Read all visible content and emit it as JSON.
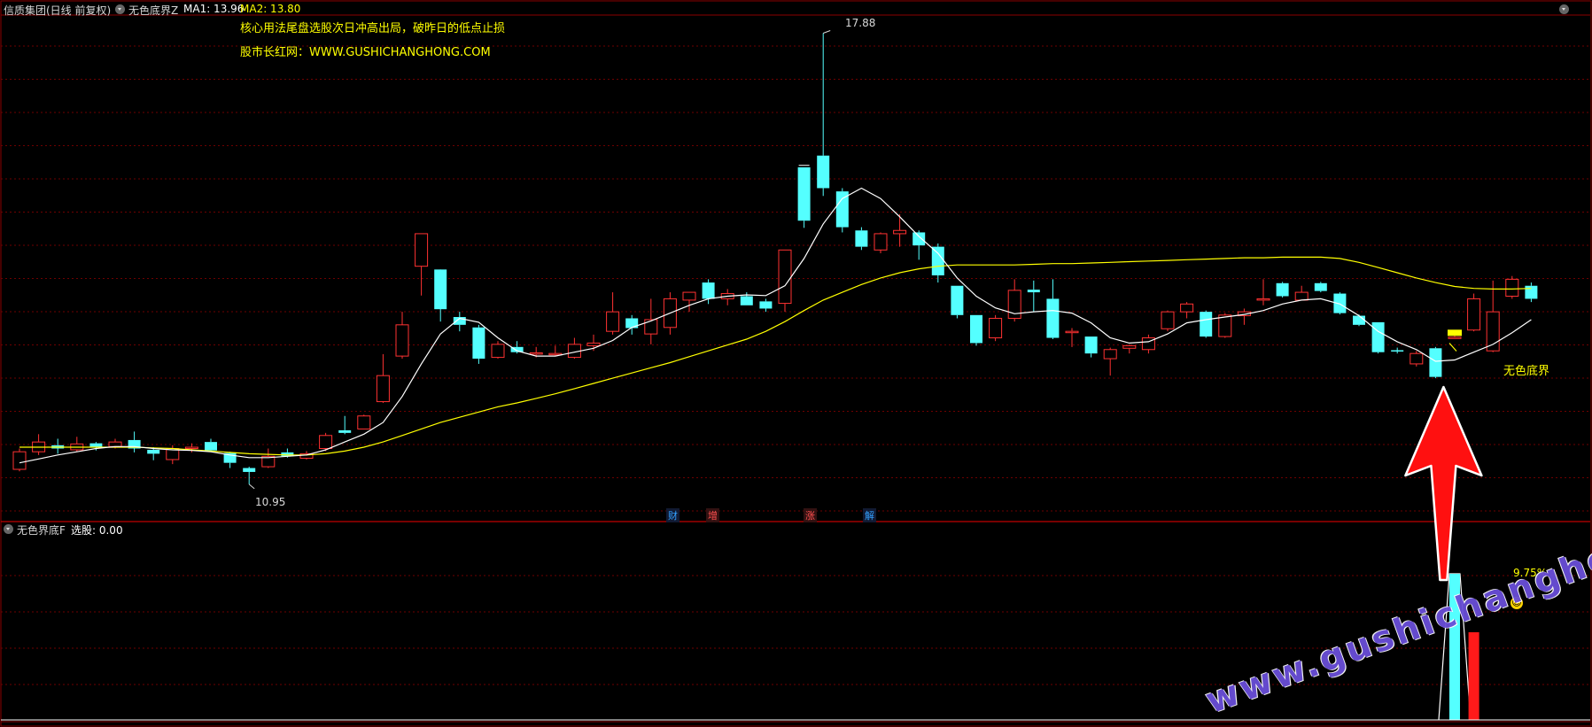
{
  "header": {
    "stock": "信质集团(日线 前复权)",
    "indicator": "无色底界Z",
    "ma1_label": "MA1: 13.96",
    "ma2_label": "MA2: 13.80"
  },
  "annotations": {
    "line1": "核心用法尾盘选股次日冲高出局，破昨日的低点止损",
    "line2": "股市长红网：WWW.GUSHICHANGHONG.COM"
  },
  "signal_label": "无色底界",
  "price_labels": {
    "high": "17.88",
    "low": "10.95"
  },
  "event_tags": [
    {
      "text": "财",
      "color": "#33a0ff"
    },
    {
      "text": "增",
      "color": "#ff5050"
    },
    {
      "text": "涨",
      "color": "#ff5050"
    },
    {
      "text": "解",
      "color": "#33a0ff"
    }
  ],
  "sub_panel": {
    "title": "无色界底F",
    "value_label": "选股: 0.00",
    "percent": "9.75%"
  },
  "watermark": "www.gushichanghong.com",
  "colors": {
    "up": "#ff3232",
    "down": "#54ffff",
    "ma1": "#ffffff",
    "ma2": "#ffff00",
    "grid": "#8b0000",
    "signal": "#ffff00"
  },
  "chart_data": {
    "type": "candlestick",
    "ylim": [
      10.5,
      18.2
    ],
    "highest": 17.88,
    "lowest": 10.95,
    "candles": [
      {
        "o": 11.18,
        "c": 11.45,
        "h": 11.5,
        "l": 11.15
      },
      {
        "o": 11.45,
        "c": 11.6,
        "h": 11.72,
        "l": 11.4
      },
      {
        "o": 11.55,
        "c": 11.5,
        "h": 11.65,
        "l": 11.42
      },
      {
        "o": 11.48,
        "c": 11.57,
        "h": 11.68,
        "l": 11.45
      },
      {
        "o": 11.58,
        "c": 11.52,
        "h": 11.6,
        "l": 11.47
      },
      {
        "o": 11.53,
        "c": 11.6,
        "h": 11.65,
        "l": 11.5
      },
      {
        "o": 11.63,
        "c": 11.5,
        "h": 11.76,
        "l": 11.44
      },
      {
        "o": 11.48,
        "c": 11.42,
        "h": 11.52,
        "l": 11.32
      },
      {
        "o": 11.33,
        "c": 11.5,
        "h": 11.55,
        "l": 11.26
      },
      {
        "o": 11.5,
        "c": 11.52,
        "h": 11.58,
        "l": 11.44
      },
      {
        "o": 11.6,
        "c": 11.47,
        "h": 11.65,
        "l": 11.45
      },
      {
        "o": 11.43,
        "c": 11.28,
        "h": 11.45,
        "l": 11.2
      },
      {
        "o": 11.2,
        "c": 11.14,
        "h": 11.22,
        "l": 10.95
      },
      {
        "o": 11.22,
        "c": 11.38,
        "h": 11.5,
        "l": 11.2
      },
      {
        "o": 11.44,
        "c": 11.38,
        "h": 11.5,
        "l": 11.36
      },
      {
        "o": 11.35,
        "c": 11.42,
        "h": 11.46,
        "l": 11.33
      },
      {
        "o": 11.5,
        "c": 11.7,
        "h": 11.74,
        "l": 11.46
      },
      {
        "o": 11.78,
        "c": 11.74,
        "h": 12.0,
        "l": 11.72
      },
      {
        "o": 11.8,
        "c": 12.0,
        "h": 12.02,
        "l": 11.8
      },
      {
        "o": 12.22,
        "c": 12.62,
        "h": 12.95,
        "l": 12.2
      },
      {
        "o": 12.92,
        "c": 13.4,
        "h": 13.6,
        "l": 12.88
      },
      {
        "o": 14.3,
        "c": 14.8,
        "h": 14.8,
        "l": 13.85
      },
      {
        "o": 14.25,
        "c": 13.64,
        "h": 13.64,
        "l": 13.45
      },
      {
        "o": 13.52,
        "c": 13.4,
        "h": 13.6,
        "l": 13.3
      },
      {
        "o": 13.36,
        "c": 12.88,
        "h": 13.4,
        "l": 12.8
      },
      {
        "o": 12.9,
        "c": 13.1,
        "h": 13.15,
        "l": 12.88
      },
      {
        "o": 13.06,
        "c": 12.98,
        "h": 13.15,
        "l": 12.96
      },
      {
        "o": 12.97,
        "c": 12.97,
        "h": 13.06,
        "l": 12.9
      },
      {
        "o": 12.95,
        "c": 12.96,
        "h": 13.08,
        "l": 12.92
      },
      {
        "o": 12.9,
        "c": 13.1,
        "h": 13.2,
        "l": 12.88
      },
      {
        "o": 13.08,
        "c": 13.12,
        "h": 13.25,
        "l": 13.0
      },
      {
        "o": 13.3,
        "c": 13.6,
        "h": 13.9,
        "l": 13.25
      },
      {
        "o": 13.5,
        "c": 13.35,
        "h": 13.55,
        "l": 13.25
      },
      {
        "o": 13.26,
        "c": 13.48,
        "h": 13.8,
        "l": 13.1
      },
      {
        "o": 13.36,
        "c": 13.8,
        "h": 13.9,
        "l": 13.25
      },
      {
        "o": 13.78,
        "c": 13.9,
        "h": 13.9,
        "l": 13.6
      },
      {
        "o": 14.05,
        "c": 13.8,
        "h": 14.1,
        "l": 13.72
      },
      {
        "o": 13.8,
        "c": 13.88,
        "h": 13.95,
        "l": 13.7
      },
      {
        "o": 13.84,
        "c": 13.7,
        "h": 13.9,
        "l": 13.7
      },
      {
        "o": 13.76,
        "c": 13.65,
        "h": 13.8,
        "l": 13.6
      },
      {
        "o": 13.73,
        "c": 14.55,
        "h": 14.55,
        "l": 13.6
      },
      {
        "o": 15.82,
        "c": 15.0,
        "h": 15.82,
        "l": 14.89
      },
      {
        "o": 16.0,
        "c": 15.5,
        "h": 17.88,
        "l": 15.38
      },
      {
        "o": 15.45,
        "c": 14.9,
        "h": 15.5,
        "l": 14.82
      },
      {
        "o": 14.85,
        "c": 14.6,
        "h": 14.9,
        "l": 14.55
      },
      {
        "o": 14.55,
        "c": 14.8,
        "h": 14.82,
        "l": 14.5
      },
      {
        "o": 14.8,
        "c": 14.85,
        "h": 15.1,
        "l": 14.6
      },
      {
        "o": 14.82,
        "c": 14.62,
        "h": 14.85,
        "l": 14.4
      },
      {
        "o": 14.6,
        "c": 14.16,
        "h": 14.65,
        "l": 14.05
      },
      {
        "o": 14.0,
        "c": 13.55,
        "h": 14.0,
        "l": 13.5
      },
      {
        "o": 13.55,
        "c": 13.12,
        "h": 13.55,
        "l": 13.08
      },
      {
        "o": 13.2,
        "c": 13.5,
        "h": 13.55,
        "l": 13.15
      },
      {
        "o": 13.5,
        "c": 13.93,
        "h": 14.1,
        "l": 13.45
      },
      {
        "o": 13.94,
        "c": 13.9,
        "h": 14.08,
        "l": 13.6
      },
      {
        "o": 13.8,
        "c": 13.2,
        "h": 14.1,
        "l": 13.18
      },
      {
        "o": 13.3,
        "c": 13.3,
        "h": 13.35,
        "l": 13.06
      },
      {
        "o": 13.22,
        "c": 12.96,
        "h": 13.22,
        "l": 12.9
      },
      {
        "o": 12.88,
        "c": 13.02,
        "h": 13.05,
        "l": 12.62
      },
      {
        "o": 13.04,
        "c": 13.08,
        "h": 13.1,
        "l": 12.96
      },
      {
        "o": 13.02,
        "c": 13.2,
        "h": 13.25,
        "l": 12.96
      },
      {
        "o": 13.34,
        "c": 13.6,
        "h": 13.62,
        "l": 13.3
      },
      {
        "o": 13.6,
        "c": 13.72,
        "h": 13.75,
        "l": 13.5
      },
      {
        "o": 13.6,
        "c": 13.22,
        "h": 13.62,
        "l": 13.2
      },
      {
        "o": 13.22,
        "c": 13.55,
        "h": 13.58,
        "l": 13.2
      },
      {
        "o": 13.54,
        "c": 13.6,
        "h": 13.65,
        "l": 13.4
      },
      {
        "o": 13.78,
        "c": 13.8,
        "h": 14.1,
        "l": 13.7
      },
      {
        "o": 14.04,
        "c": 13.84,
        "h": 14.06,
        "l": 13.82
      },
      {
        "o": 13.78,
        "c": 13.9,
        "h": 14.0,
        "l": 13.78
      },
      {
        "o": 14.04,
        "c": 13.92,
        "h": 14.06,
        "l": 13.9
      },
      {
        "o": 13.88,
        "c": 13.58,
        "h": 13.9,
        "l": 13.56
      },
      {
        "o": 13.54,
        "c": 13.4,
        "h": 13.56,
        "l": 13.38
      },
      {
        "o": 13.44,
        "c": 12.98,
        "h": 13.44,
        "l": 12.96
      },
      {
        "o": 13.01,
        "c": 13.0,
        "h": 13.05,
        "l": 12.96
      },
      {
        "o": 12.8,
        "c": 12.96,
        "h": 13.0,
        "l": 12.76
      },
      {
        "o": 13.04,
        "c": 12.6,
        "h": 13.06,
        "l": 12.58
      },
      {
        "o": 13.2,
        "c": 13.21,
        "h": 13.23,
        "l": 13.2
      },
      {
        "o": 13.32,
        "c": 13.8,
        "h": 13.88,
        "l": 13.3
      },
      {
        "o": 13.0,
        "c": 13.6,
        "h": 14.08,
        "l": 12.98
      },
      {
        "o": 13.84,
        "c": 14.1,
        "h": 14.15,
        "l": 13.8
      },
      {
        "o": 14.0,
        "c": 13.8,
        "h": 14.05,
        "l": 13.75
      }
    ],
    "ma1": [
      11.28,
      11.34,
      11.4,
      11.45,
      11.5,
      11.53,
      11.53,
      11.5,
      11.48,
      11.47,
      11.45,
      11.4,
      11.36,
      11.36,
      11.38,
      11.4,
      11.48,
      11.6,
      11.72,
      11.9,
      12.3,
      12.8,
      13.26,
      13.5,
      13.44,
      13.2,
      13.0,
      12.92,
      12.92,
      12.98,
      13.04,
      13.16,
      13.36,
      13.46,
      13.58,
      13.7,
      13.8,
      13.84,
      13.86,
      13.85,
      14.0,
      14.42,
      14.95,
      15.34,
      15.5,
      15.34,
      15.06,
      14.76,
      14.5,
      14.12,
      13.84,
      13.66,
      13.57,
      13.6,
      13.62,
      13.58,
      13.43,
      13.2,
      13.12,
      13.14,
      13.26,
      13.43,
      13.48,
      13.52,
      13.56,
      13.62,
      13.72,
      13.78,
      13.8,
      13.72,
      13.54,
      13.3,
      13.14,
      13.02,
      12.84,
      12.86,
      12.98,
      13.1,
      13.28,
      13.48
    ],
    "ma2": [
      11.52,
      11.52,
      11.52,
      11.52,
      11.52,
      11.52,
      11.52,
      11.51,
      11.5,
      11.48,
      11.46,
      11.44,
      11.42,
      11.41,
      11.4,
      11.4,
      11.42,
      11.46,
      11.52,
      11.6,
      11.7,
      11.8,
      11.9,
      11.98,
      12.06,
      12.14,
      12.2,
      12.27,
      12.34,
      12.42,
      12.5,
      12.58,
      12.66,
      12.74,
      12.82,
      12.91,
      13.0,
      13.09,
      13.18,
      13.3,
      13.45,
      13.62,
      13.78,
      13.9,
      14.02,
      14.12,
      14.2,
      14.26,
      14.3,
      14.32,
      14.32,
      14.32,
      14.32,
      14.33,
      14.34,
      14.34,
      14.35,
      14.36,
      14.37,
      14.38,
      14.39,
      14.4,
      14.41,
      14.42,
      14.43,
      14.43,
      14.44,
      14.44,
      14.44,
      14.42,
      14.36,
      14.28,
      14.2,
      14.12,
      14.05,
      13.99,
      13.96,
      13.95,
      13.95,
      13.96
    ],
    "signal_index": 74,
    "signal_box_index": 75,
    "event_tag_indices": [
      34,
      36,
      41,
      44
    ],
    "sub": {
      "spike_index": 75,
      "spike_value": 1.0,
      "red_bar_index": 76,
      "red_bar_value": 0.6
    }
  }
}
